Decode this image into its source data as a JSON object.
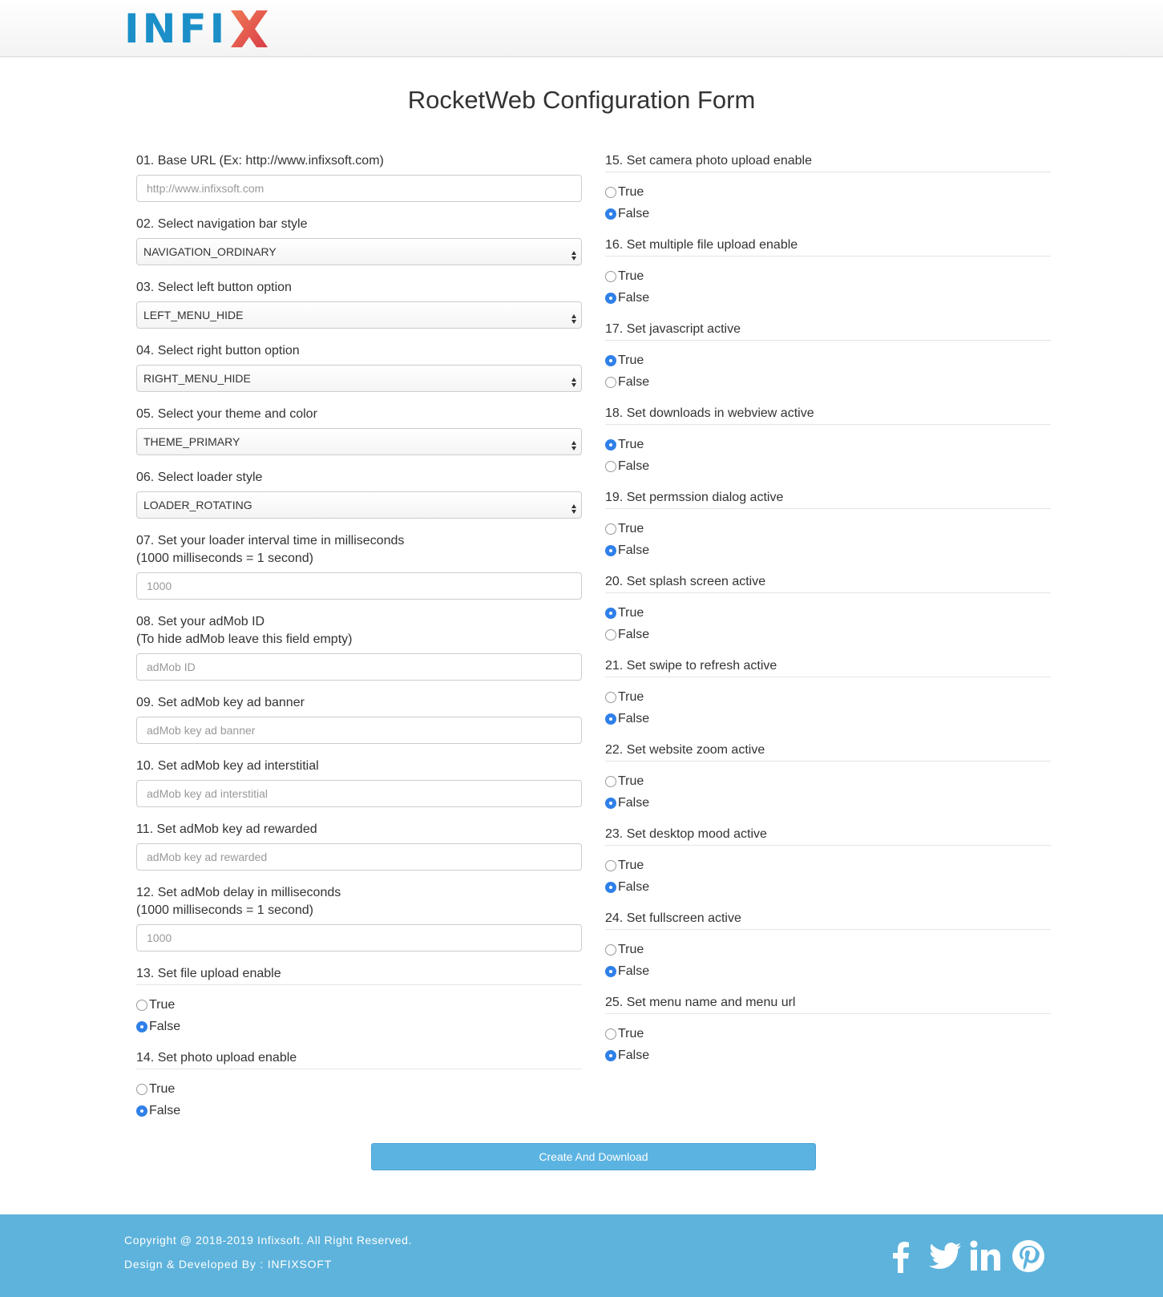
{
  "brand": {
    "logo_text": "INFI",
    "logo_text_x": "X"
  },
  "page": {
    "title": "RocketWeb Configuration Form"
  },
  "form": {
    "left_fields": [
      {
        "kind": "input",
        "label": "01. Base URL (Ex: http://www.infixsoft.com)",
        "value": "",
        "placeholder": "http://www.infixsoft.com"
      },
      {
        "kind": "select",
        "label": "02. Select navigation bar style",
        "selected": "NAVIGATION_ORDINARY"
      },
      {
        "kind": "select",
        "label": "03. Select left button option",
        "selected": "LEFT_MENU_HIDE"
      },
      {
        "kind": "select",
        "label": "04. Select right button option",
        "selected": "RIGHT_MENU_HIDE"
      },
      {
        "kind": "select",
        "label": "05. Select your theme and color",
        "selected": "THEME_PRIMARY"
      },
      {
        "kind": "select",
        "label": "06. Select loader style",
        "selected": "LOADER_ROTATING"
      },
      {
        "kind": "input",
        "label": "07. Set your loader interval time in milliseconds",
        "label2": "(1000 milliseconds = 1 second)",
        "value": "",
        "placeholder": "1000"
      },
      {
        "kind": "input",
        "label": "08. Set your adMob ID",
        "label2": "(To hide adMob leave this field empty)",
        "value": "",
        "placeholder": "adMob ID"
      },
      {
        "kind": "input",
        "label": "09. Set adMob key ad banner",
        "value": "",
        "placeholder": "adMob key ad banner"
      },
      {
        "kind": "input",
        "label": "10. Set adMob key ad interstitial",
        "value": "",
        "placeholder": "adMob key ad interstitial"
      },
      {
        "kind": "input",
        "label": "11. Set adMob key ad rewarded",
        "value": "",
        "placeholder": "adMob key ad rewarded"
      },
      {
        "kind": "input",
        "label": "12. Set adMob delay in milliseconds",
        "label2": "(1000 milliseconds = 1 second)",
        "value": "",
        "placeholder": "1000"
      },
      {
        "kind": "radio",
        "label": "13. Set file upload enable",
        "selected": "False"
      },
      {
        "kind": "radio",
        "label": "14. Set photo upload enable",
        "selected": "False"
      }
    ],
    "right_fields": [
      {
        "kind": "radio",
        "label": "15. Set camera photo upload enable",
        "selected": "False"
      },
      {
        "kind": "radio",
        "label": "16. Set multiple file upload enable",
        "selected": "False"
      },
      {
        "kind": "radio",
        "label": "17. Set javascript active",
        "selected": "True"
      },
      {
        "kind": "radio",
        "label": "18. Set downloads in webview active",
        "selected": "True"
      },
      {
        "kind": "radio",
        "label": "19. Set permssion dialog active",
        "selected": "False"
      },
      {
        "kind": "radio",
        "label": "20. Set splash screen active",
        "selected": "True"
      },
      {
        "kind": "radio",
        "label": "21. Set swipe to refresh active",
        "selected": "False"
      },
      {
        "kind": "radio",
        "label": "22. Set website zoom active",
        "selected": "False"
      },
      {
        "kind": "radio",
        "label": "23. Set desktop mood active",
        "selected": "False"
      },
      {
        "kind": "radio",
        "label": "24. Set fullscreen active",
        "selected": "False"
      },
      {
        "kind": "radio",
        "label": "25. Set menu name and menu url",
        "selected": "False"
      }
    ],
    "radio_options": [
      "True",
      "False"
    ],
    "submit_label": "Create And Download"
  },
  "footer": {
    "copyright": "Copyright @ 2018-2019 Infixsoft. All Right Reserved.",
    "developer": "Design & Developed By : INFIXSOFT",
    "social_icons": [
      "facebook-icon",
      "twitter-icon",
      "linkedin-icon",
      "pinterest-icon"
    ]
  },
  "colors": {
    "brand_blue": "#1b8fc8",
    "accent": "#5eb3dc",
    "radio_checked": "#2f80e8",
    "logo_x": "#e8604c"
  }
}
